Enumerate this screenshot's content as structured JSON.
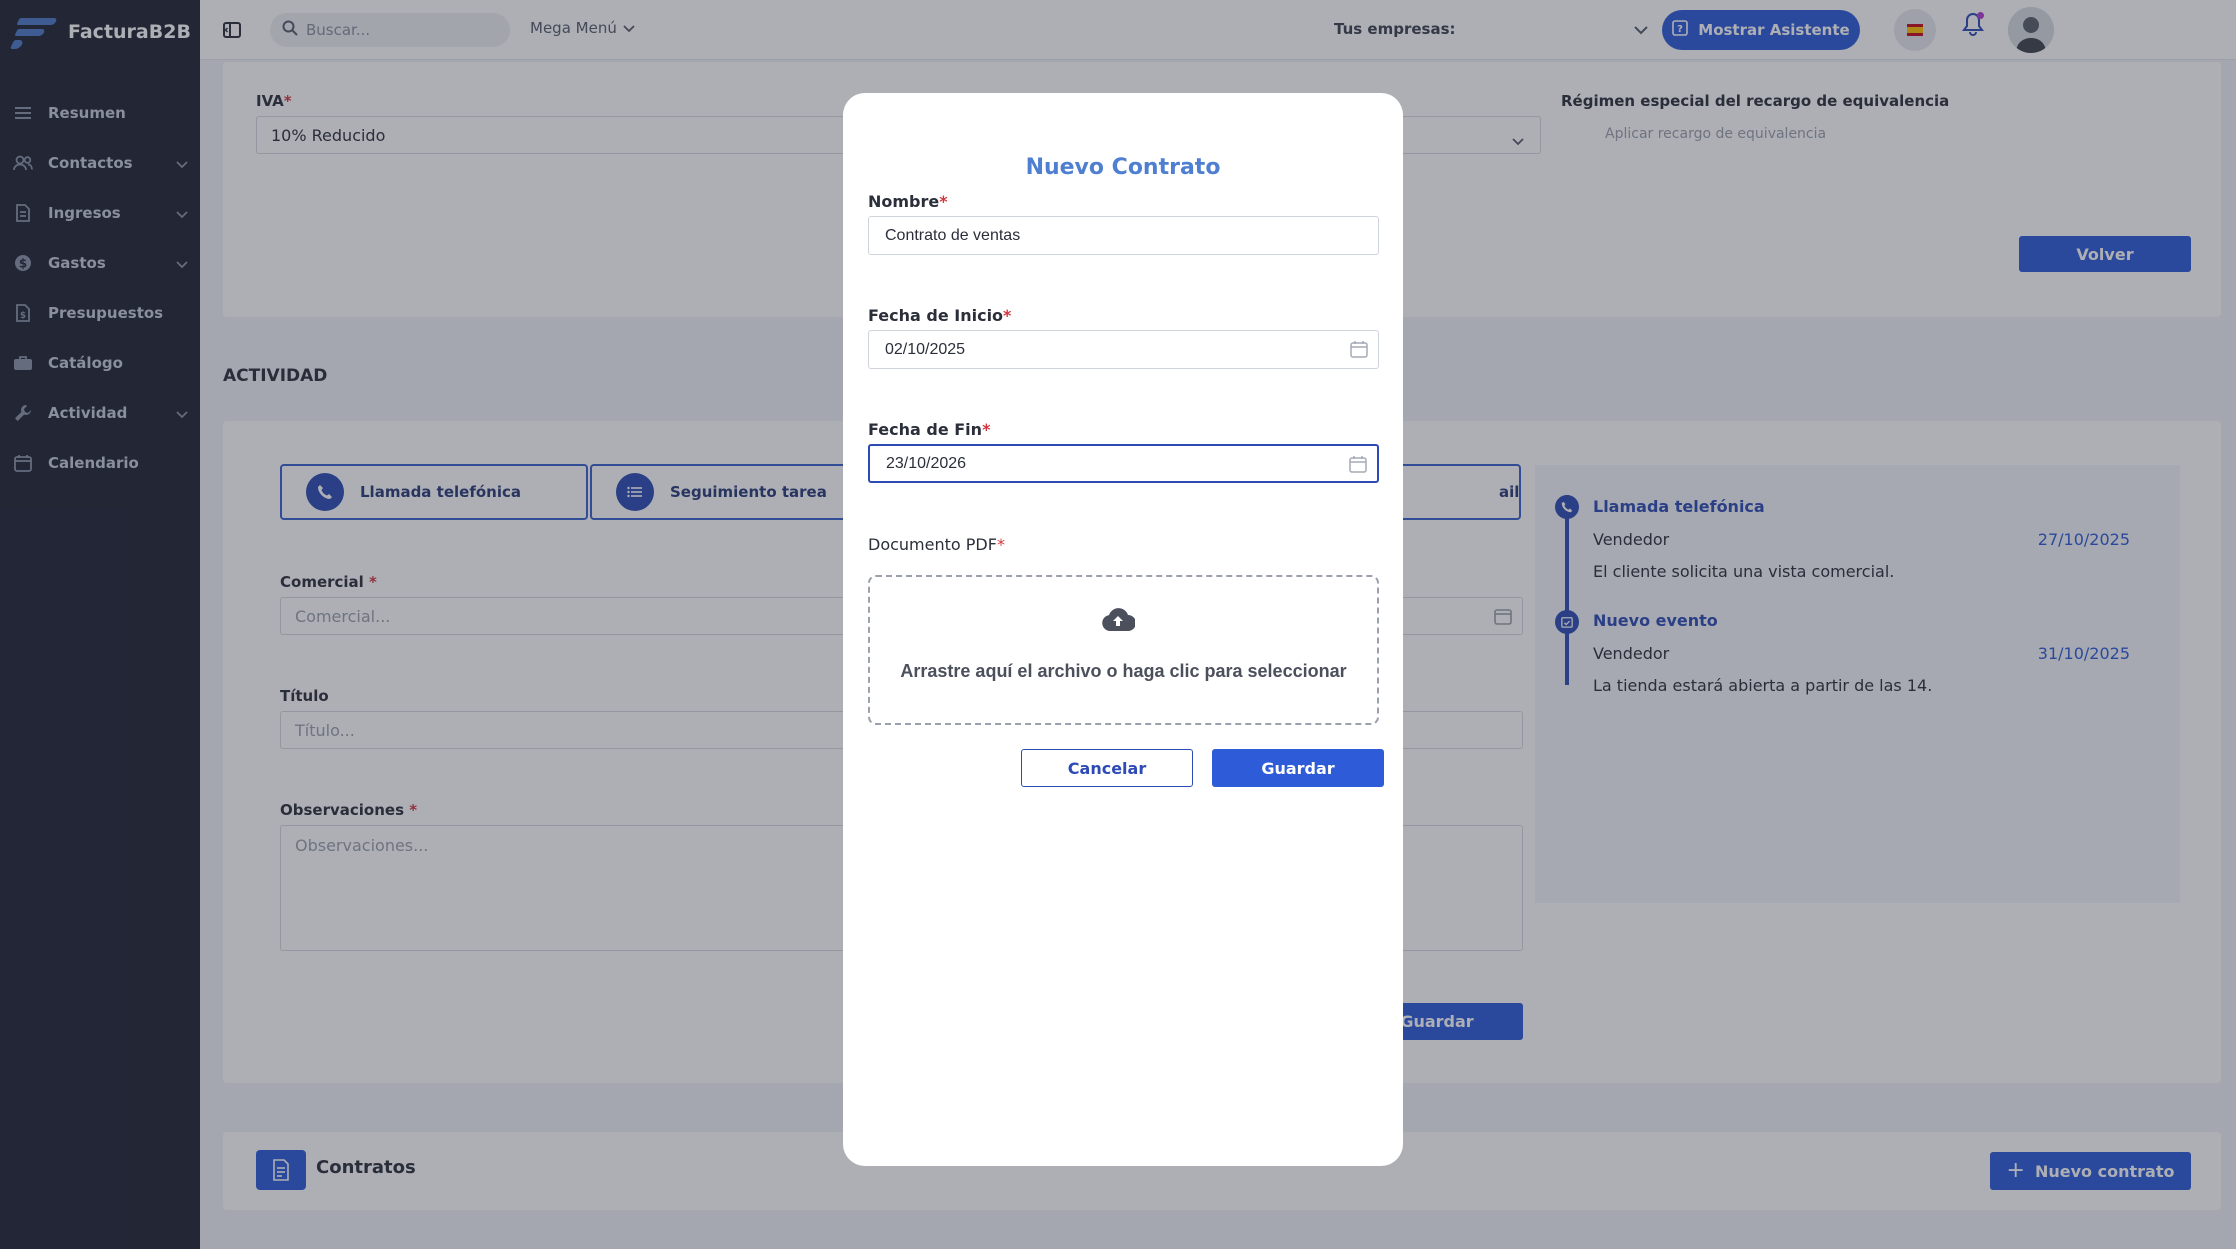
{
  "brand": {
    "name": "FacturaB2B"
  },
  "sidebar": {
    "items": [
      {
        "label": "Resumen",
        "icon": "list-icon",
        "expandable": false
      },
      {
        "label": "Contactos",
        "icon": "users-icon",
        "expandable": true
      },
      {
        "label": "Ingresos",
        "icon": "document-icon",
        "expandable": true
      },
      {
        "label": "Gastos",
        "icon": "dollar-icon",
        "expandable": true
      },
      {
        "label": "Presupuestos",
        "icon": "file-dollar-icon",
        "expandable": false
      },
      {
        "label": "Catálogo",
        "icon": "briefcase-icon",
        "expandable": false
      },
      {
        "label": "Actividad",
        "icon": "wrench-icon",
        "expandable": true
      },
      {
        "label": "Calendario",
        "icon": "calendar-icon",
        "expandable": false
      }
    ]
  },
  "topbar": {
    "search_placeholder": "Buscar...",
    "mega_menu": "Mega Menú",
    "empresas_label": "Tus empresas:",
    "assistant_button": "Mostrar Asistente"
  },
  "background": {
    "iva_label": "IVA",
    "iva_value": "10% Reducido",
    "regimen_label": "Régimen especial del recargo de equivalencia",
    "regimen_option": "Aplicar recargo de equivalencia",
    "volver_button": "Volver",
    "actividad_title": "ACTIVIDAD",
    "chips": [
      "Llamada telefónica",
      "Seguimiento tarea",
      "ail"
    ],
    "comercial_label": "Comercial",
    "comercial_placeholder": "Comercial...",
    "titulo_label": "Título",
    "titulo_placeholder": "Título...",
    "observaciones_label": "Observaciones",
    "observaciones_placeholder": "Observaciones...",
    "guardar_button": "Guardar",
    "timeline": [
      {
        "title": "Llamada telefónica",
        "role": "Vendedor",
        "date": "27/10/2025",
        "desc": "El cliente solicita una vista comercial."
      },
      {
        "title": "Nuevo evento",
        "role": "Vendedor",
        "date": "31/10/2025",
        "desc": "La tienda estará abierta a partir de las 14."
      }
    ],
    "contratos_title": "Contratos",
    "nuevo_contrato_button": "Nuevo contrato"
  },
  "modal": {
    "title": "Nuevo Contrato",
    "nombre_label": "Nombre",
    "nombre_value": "Contrato de ventas",
    "fecha_inicio_label": "Fecha de Inicio",
    "fecha_inicio_value": "02/10/2025",
    "fecha_fin_label": "Fecha de Fin",
    "fecha_fin_value": "23/10/2026",
    "documento_label": "Documento PDF",
    "dropzone_text": "Arrastre aquí el archivo o haga clic para seleccionar",
    "cancel_button": "Cancelar",
    "save_button": "Guardar"
  },
  "colors": {
    "sidebar_bg": "#1f2333",
    "primary": "#2e5bd8",
    "modal_title": "#4f7fd0",
    "required": "#d3353f"
  }
}
